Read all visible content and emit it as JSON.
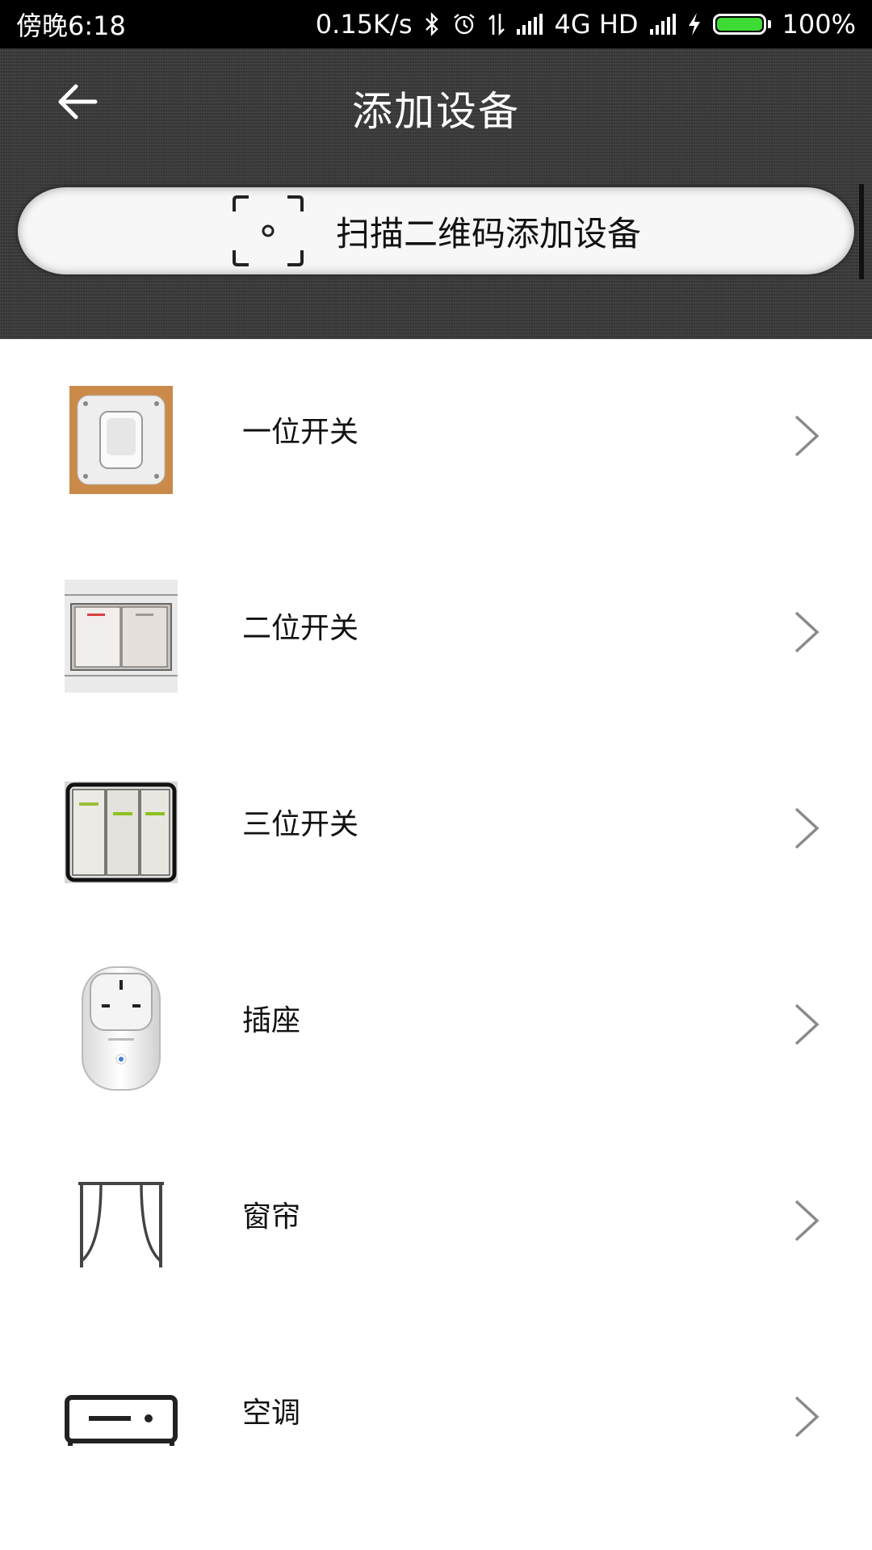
{
  "status_bar": {
    "time": "傍晚6:18",
    "net_speed": "0.15K/s",
    "network": "4G HD",
    "battery": "100%",
    "icons": [
      "bluetooth-icon",
      "alarm-icon",
      "data-arrows-icon",
      "signal-icon",
      "signal-icon",
      "charging-icon",
      "battery-icon"
    ]
  },
  "header": {
    "title": "添加设备",
    "scan_label": "扫描二维码添加设备",
    "back_icon": "arrow-left-icon",
    "scan_icon": "qr-scan-icon"
  },
  "devices": [
    {
      "label": "一位开关",
      "icon": "single-switch-icon"
    },
    {
      "label": "二位开关",
      "icon": "double-switch-icon"
    },
    {
      "label": "三位开关",
      "icon": "triple-switch-icon"
    },
    {
      "label": "插座",
      "icon": "socket-icon"
    },
    {
      "label": "窗帘",
      "icon": "curtain-icon"
    },
    {
      "label": "空调",
      "icon": "air-conditioner-icon"
    }
  ],
  "colors": {
    "header_bg": "#3a3a3a",
    "battery_fill": "#3ddc34",
    "chevron": "#8a8a8a"
  }
}
